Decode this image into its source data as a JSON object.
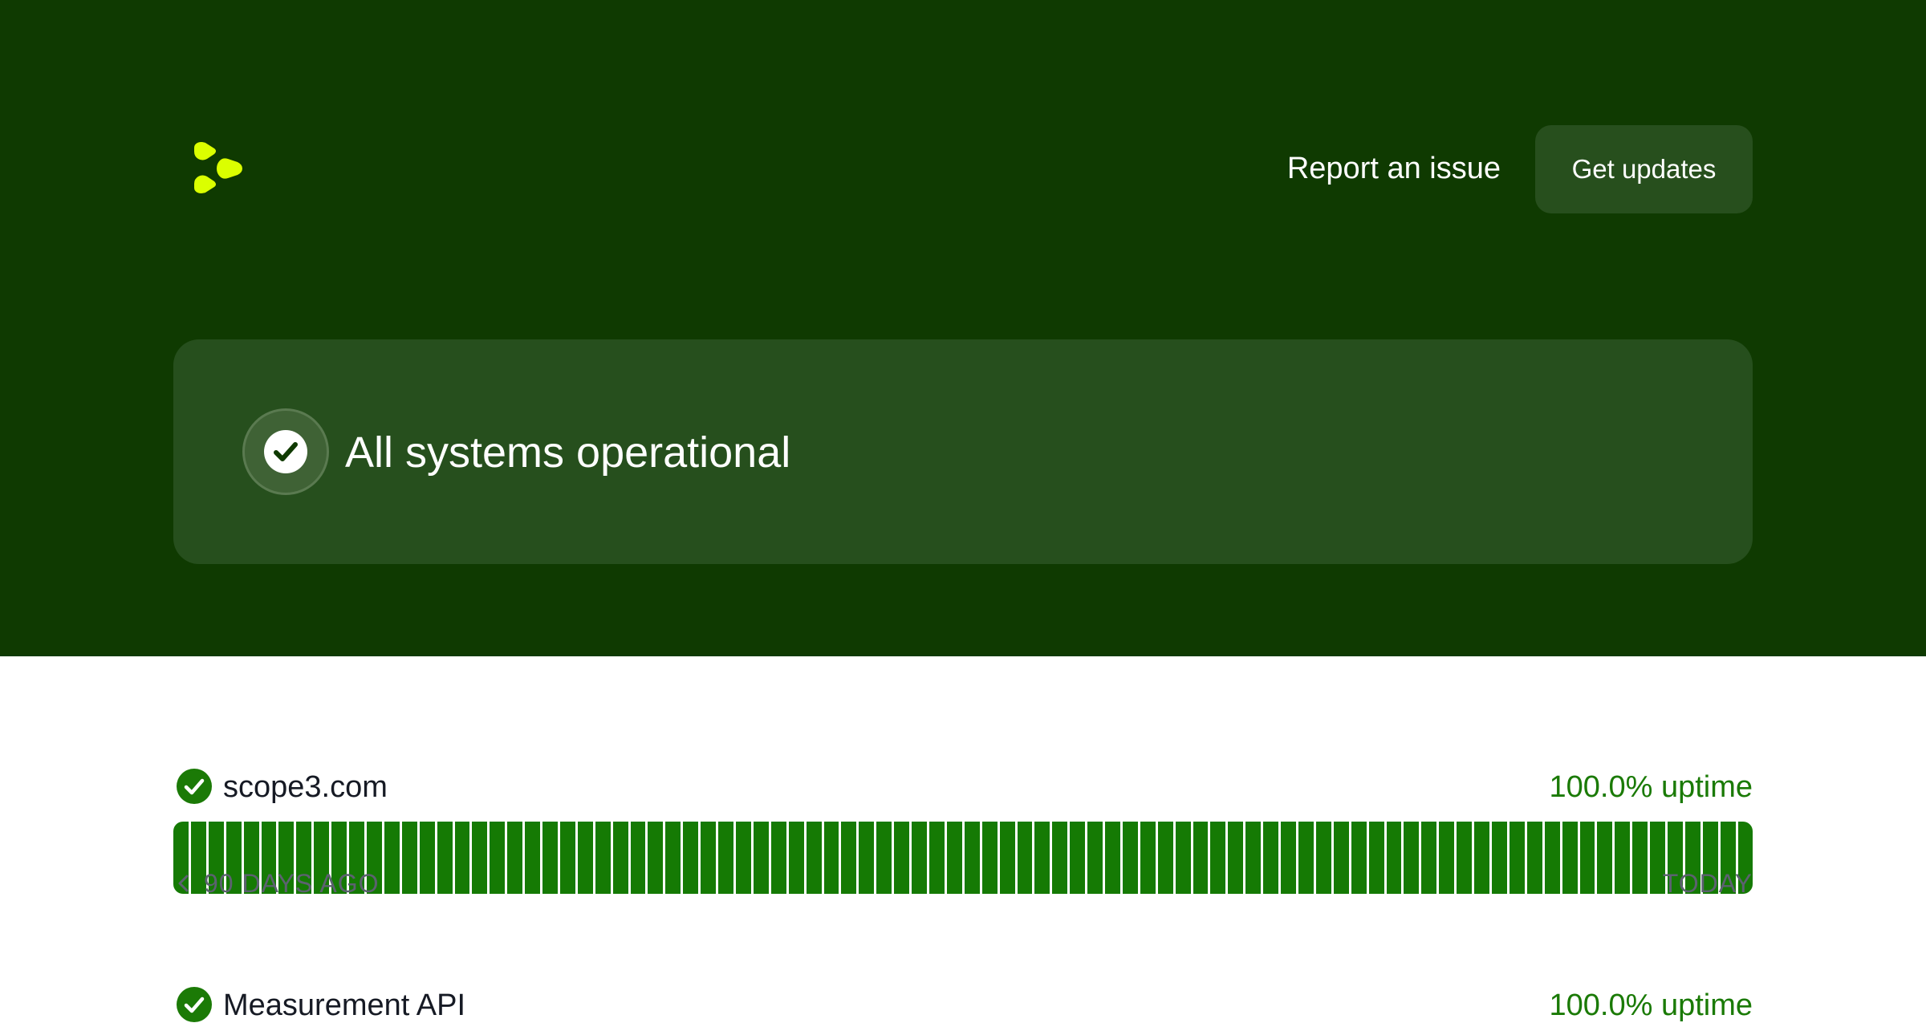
{
  "header": {
    "logo_icon": "brand-logo-icon",
    "brand_color": "#dbff00",
    "report_label": "Report an issue",
    "updates_label": "Get updates"
  },
  "status": {
    "icon": "check-circle-icon",
    "title": "All systems operational"
  },
  "colors": {
    "hero_background": "#0f3a01",
    "card_background": "#264f1d",
    "operational_green": "#157a04",
    "uptime_text": "#1a7a05"
  },
  "components": [
    {
      "name": "scope3.com",
      "status_icon": "check-circle-icon",
      "uptime": "100.0% uptime",
      "days": 90,
      "days_status": "operational",
      "range_start_label": "90 DAYS AGO",
      "range_end_label": "TODAY",
      "prev_icon": "chevron-left-icon"
    },
    {
      "name": "Measurement API",
      "status_icon": "check-circle-icon",
      "uptime": "100.0% uptime"
    }
  ]
}
